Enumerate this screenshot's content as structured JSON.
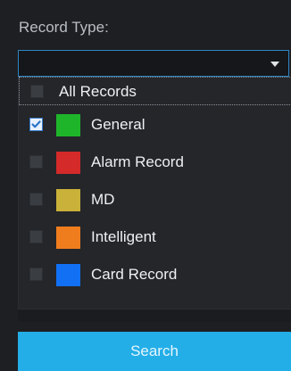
{
  "record_type": {
    "label": "Record Type:",
    "selected_value": ""
  },
  "options": [
    {
      "label": "All Records",
      "checked": false,
      "color": null
    },
    {
      "label": "General",
      "checked": true,
      "color": "#1fb52a"
    },
    {
      "label": "Alarm Record",
      "checked": false,
      "color": "#d42a2a"
    },
    {
      "label": "MD",
      "checked": false,
      "color": "#c9b13a"
    },
    {
      "label": "Intelligent",
      "checked": false,
      "color": "#ef7d1d"
    },
    {
      "label": "Card Record",
      "checked": false,
      "color": "#1170f3"
    }
  ],
  "icons": {
    "dropdown_arrow": "chevron-down-icon",
    "check": "check-icon"
  },
  "search": {
    "label": "Search",
    "color": "#23aee8"
  }
}
